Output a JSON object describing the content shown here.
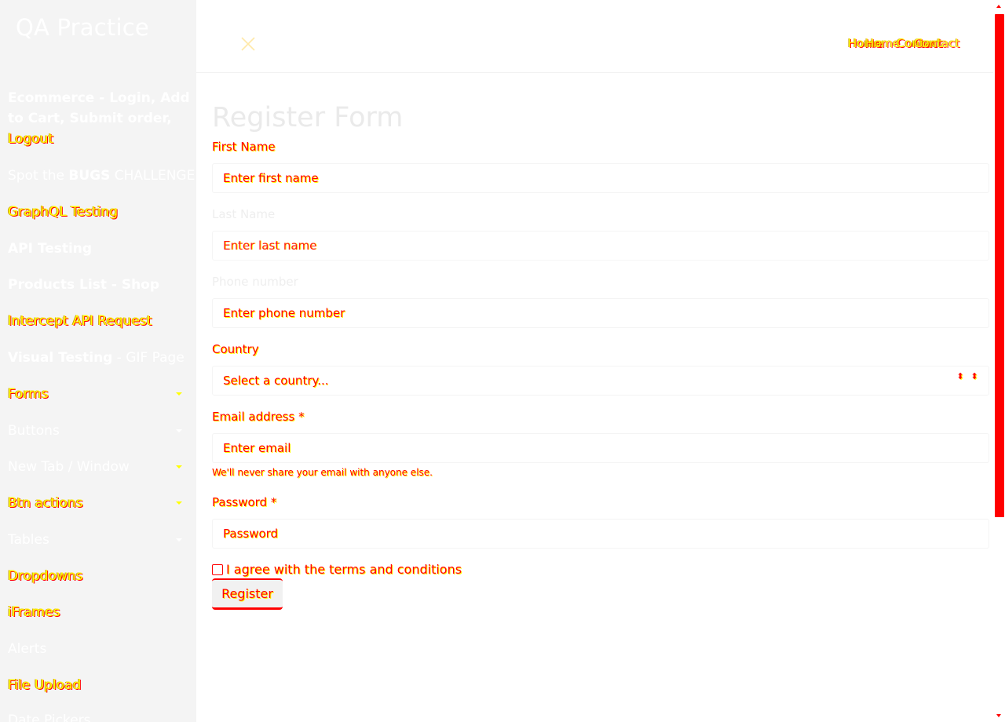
{
  "sidebar": {
    "brand": "QA Practice",
    "items": [
      {
        "label": "Ecommerce - Login, Add to Cart, Submit order, Logout"
      },
      {
        "prefix": "Spot the ",
        "bold": "BUGS",
        "suffix": " CHALLENGE"
      },
      {
        "label": "GraphQL Testing"
      },
      {
        "label": "API Testing"
      },
      {
        "label": "Products List - Shop"
      },
      {
        "label": "Intercept API Request"
      },
      {
        "bold": "Visual Testing",
        "suffix": " - GIF Page"
      },
      {
        "label": "Forms"
      },
      {
        "label": "Buttons"
      },
      {
        "label": "New Tab / Window"
      },
      {
        "label": "Btn actions"
      },
      {
        "label": "Tables"
      },
      {
        "label": "Dropdowns"
      },
      {
        "label": "iFrames"
      },
      {
        "label": "Alerts"
      },
      {
        "label": "File Upload"
      },
      {
        "label": "Date Pickers"
      }
    ]
  },
  "topbar": {
    "home": "Home",
    "contact": "Contact"
  },
  "form": {
    "title": "Register Form",
    "first_name_label": "First Name",
    "first_name_placeholder": "Enter first name",
    "last_name_label": "Last Name",
    "last_name_placeholder": "Enter last name",
    "phone_label": "Phone number",
    "phone_placeholder": "Enter phone number",
    "country_label": "Country",
    "country_value": "Select a country...",
    "email_label": "Email address *",
    "email_placeholder": "Enter email",
    "email_help": "We'll never share your email with anyone else.",
    "password_label": "Password *",
    "password_placeholder": "Password",
    "terms_label": "I agree with the terms and conditions",
    "register_button": "Register"
  },
  "colors": {
    "highlight": "#ffff00",
    "accent": "#ff0000",
    "sidebar_bg": "#f4f4f4"
  }
}
